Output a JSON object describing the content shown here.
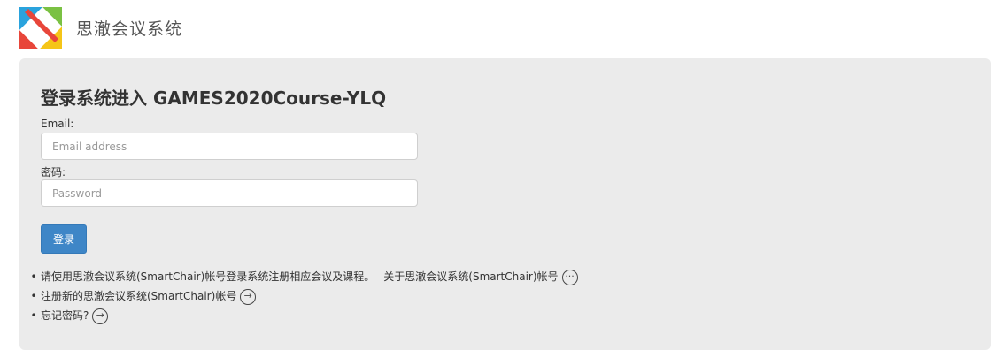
{
  "header": {
    "app_title": "思澈会议系统",
    "logo_icon": "smartchair-logo-icon"
  },
  "login": {
    "heading": "登录系统进入 GAMES2020Course-YLQ",
    "email_label": "Email:",
    "email_placeholder": "Email address",
    "email_value": "",
    "password_label": "密码:",
    "password_placeholder": "Password",
    "password_value": "",
    "submit_label": "登录",
    "accent_color": "#3e86c7"
  },
  "links": {
    "item1_text": "请使用思澈会议系统(SmartChair)帐号登录系统注册相应会议及课程。",
    "item1_about": "关于思澈会议系统(SmartChair)帐号",
    "item1_icon": "more-icon",
    "item2_text": "注册新的思澈会议系统(SmartChair)帐号",
    "item2_icon": "arrow-right-icon",
    "item3_text": "忘记密码?",
    "item3_icon": "arrow-right-icon"
  }
}
